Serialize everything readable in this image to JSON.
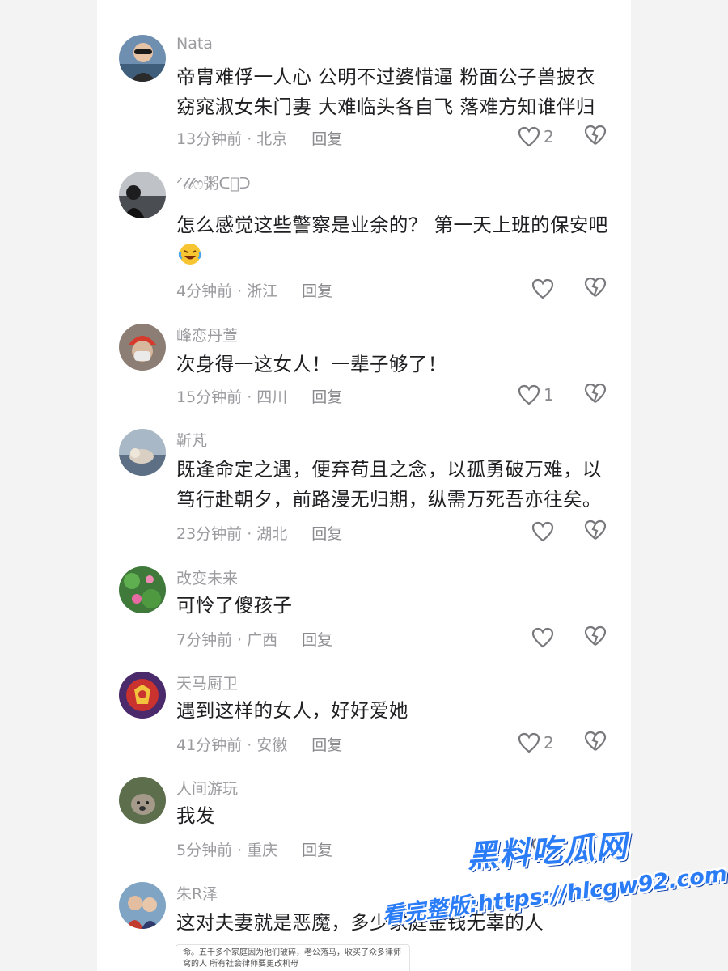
{
  "comments": [
    {
      "user": "Nata",
      "text": "帝胄难俘一人心 公明不过婆惜逼  粉面公子兽披衣 窈窕淑女朱门妻 大难临头各自飞 落难方知谁伴归",
      "time": "13分钟前",
      "location": "北京",
      "reply": "回复",
      "likes": "2"
    },
    {
      "user": "ᐟ𝓁𝓁ෆ粥ᑕ᷊ᑐ",
      "text": "怎么感觉这些警察是业余的？  第一天上班的保安吧",
      "time": "4分钟前",
      "location": "浙江",
      "reply": "回复",
      "likes": ""
    },
    {
      "user": "峰恋丹萱",
      "text": "次身得一这女人！一辈子够了！",
      "time": "15分钟前",
      "location": "四川",
      "reply": "回复",
      "likes": "1"
    },
    {
      "user": "靳芃",
      "text": "既逢命定之遇，便弃苟且之念，以孤勇破万难，以笃行赴朝夕，前路漫无归期，纵需万死吾亦往矣。",
      "time": "23分钟前",
      "location": "湖北",
      "reply": "回复",
      "likes": ""
    },
    {
      "user": "改变未来",
      "text": "可怜了傻孩子",
      "time": "7分钟前",
      "location": "广西",
      "reply": "回复",
      "likes": ""
    },
    {
      "user": "天马厨卫",
      "text": "遇到这样的女人，好好爱她",
      "time": "41分钟前",
      "location": "安徽",
      "reply": "回复",
      "likes": "2"
    },
    {
      "user": "人间游玩",
      "text": "我发",
      "time": "5分钟前",
      "location": "重庆",
      "reply": "回复",
      "likes": ""
    },
    {
      "user": "朱R泽",
      "text": "这对夫妻就是恶魔，多少家庭金钱无辜的人",
      "time": "",
      "location": "",
      "reply": "",
      "likes": ""
    }
  ],
  "meta_separator": "·",
  "watermark": {
    "title": "黑料吃瓜网",
    "url": "看完整版:https://hlcgw92.com"
  },
  "doc_snippet": "命。五千多个家庭因为他们破碎，老公落马，收买了众多律师窝的人 所有社会律师要更改机母",
  "colors": {
    "text": "#1f1f22",
    "muted": "#9b9b9f",
    "background": "#f3f3f4",
    "panel": "#ffffff",
    "watermark": "#2b7cf7"
  }
}
